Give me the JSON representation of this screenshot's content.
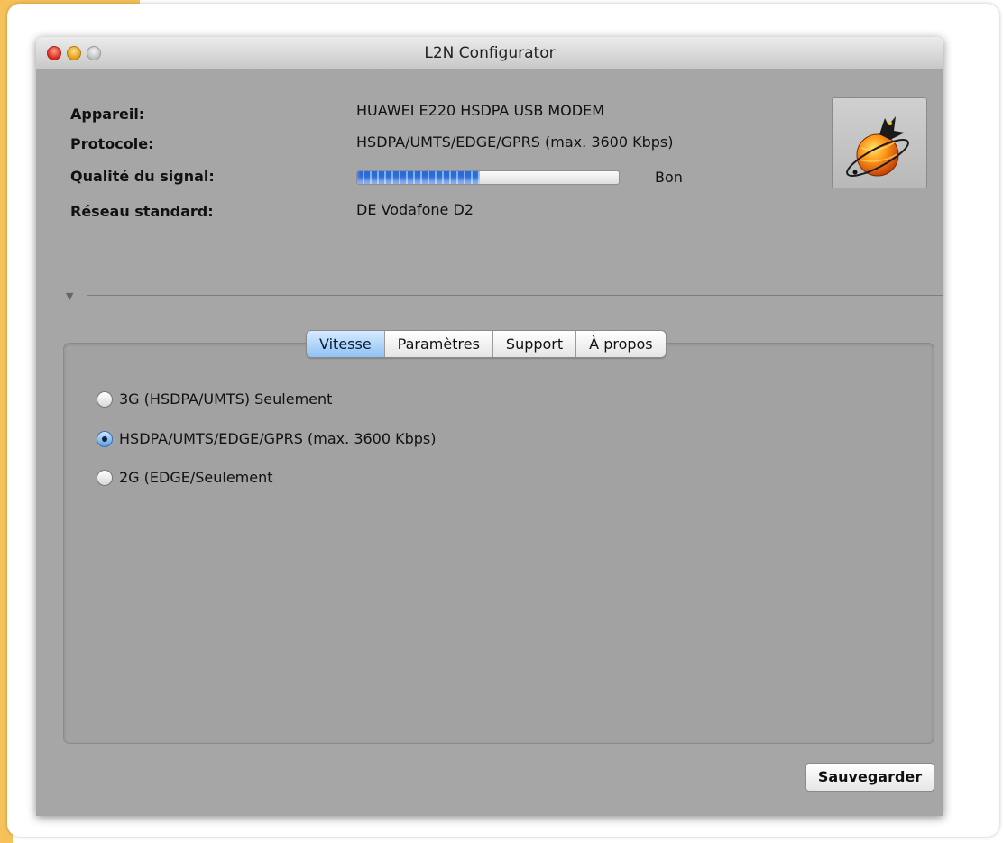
{
  "window": {
    "title": "L2N Configurator"
  },
  "info": {
    "device_label": "Appareil:",
    "device_value": "HUAWEI E220 HSDPA USB MODEM",
    "protocol_label": "Protocole:",
    "protocol_value": "HSDPA/UMTS/EDGE/GPRS (max. 3600 Kbps)",
    "signal_label": "Qualité du signal:",
    "signal_level": 0.47,
    "signal_text": "Bon",
    "network_label": "Réseau standard:",
    "network_value": "DE Vodafone D2"
  },
  "tabs": [
    {
      "label": "Vitesse",
      "selected": true
    },
    {
      "label": "Paramètres",
      "selected": false
    },
    {
      "label": "Support",
      "selected": false
    },
    {
      "label": "À propos",
      "selected": false
    }
  ],
  "speed_options": [
    {
      "label": "3G (HSDPA/UMTS) Seulement",
      "checked": false
    },
    {
      "label": "HSDPA/UMTS/EDGE/GPRS (max. 3600 Kbps)",
      "checked": true
    },
    {
      "label": "2G (EDGE/Seulement",
      "checked": false
    }
  ],
  "buttons": {
    "save_label": "Sauvegarder"
  },
  "icons": {
    "logo": "globe-bird-logo-icon",
    "disclosure": "disclosure-triangle-icon"
  },
  "colors": {
    "window_bg": "#a6a6a6",
    "accent_blue": "#2a6bd8",
    "page_edge": "#f6c15a"
  }
}
